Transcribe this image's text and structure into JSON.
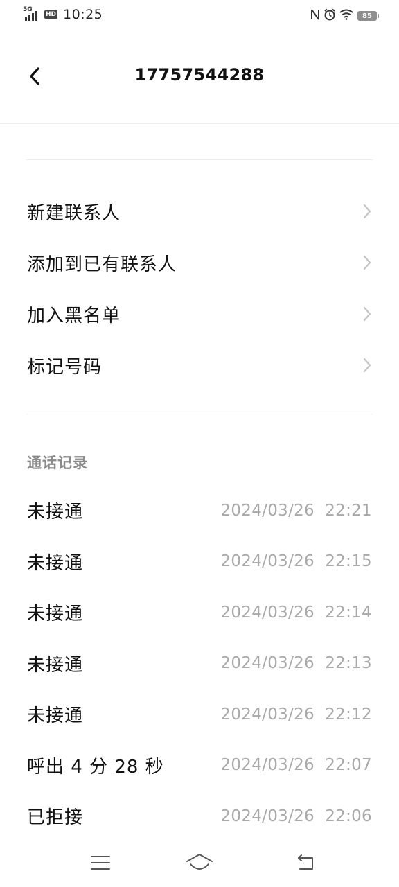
{
  "status_bar": {
    "network": "5G",
    "hd": "HD",
    "time": "10:25",
    "battery": "85"
  },
  "header": {
    "title": "17757544288"
  },
  "actions": [
    {
      "label": "新建联系人"
    },
    {
      "label": "添加到已有联系人"
    },
    {
      "label": "加入黑名单"
    },
    {
      "label": "标记号码"
    }
  ],
  "call_log": {
    "title": "通话记录",
    "entries": [
      {
        "type": "未接通",
        "time": "2024/03/26  22:21"
      },
      {
        "type": "未接通",
        "time": "2024/03/26  22:15"
      },
      {
        "type": "未接通",
        "time": "2024/03/26  22:14"
      },
      {
        "type": "未接通",
        "time": "2024/03/26  22:13"
      },
      {
        "type": "未接通",
        "time": "2024/03/26  22:12"
      },
      {
        "type": "呼出 4 分 28 秒",
        "time": "2024/03/26  22:07"
      },
      {
        "type": "已拒接",
        "time": "2024/03/26  22:06"
      }
    ]
  },
  "nav": {
    "icons": [
      "menu-icon",
      "home-icon",
      "back-icon"
    ]
  },
  "colors": {
    "text_primary": "#111111",
    "text_secondary": "#a9a9a9",
    "section_title": "#8a8a8a",
    "divider": "#ececec"
  }
}
